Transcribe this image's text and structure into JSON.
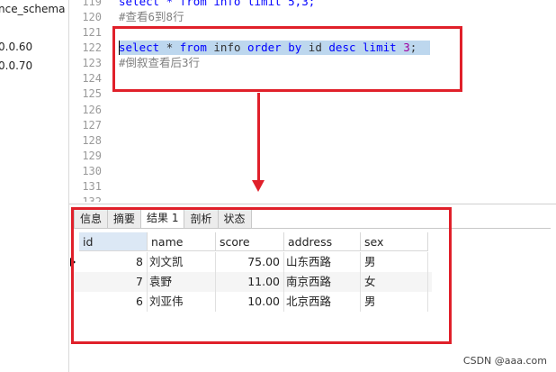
{
  "sidebar": {
    "items": [
      "nce_schema",
      "0.0.60",
      "0.0.70"
    ]
  },
  "editor": {
    "line_numbers": [
      "119",
      "120",
      "121",
      "122",
      "123",
      "124",
      "125",
      "126",
      "127",
      "128",
      "129",
      "130",
      "131",
      "132"
    ],
    "line_119": "select * from info limit 5,3;",
    "line_120_comment": "#查看6到8行",
    "line_122": {
      "kw_select": "select",
      "star": "*",
      "kw_from": "from",
      "table": "info",
      "kw_order": "order",
      "kw_by": "by",
      "col": "id",
      "kw_desc": "desc",
      "kw_limit": "limit",
      "num": "3",
      "semi": ";"
    },
    "line_123_comment": "#倒叙查看后3行"
  },
  "results": {
    "tabs": [
      "信息",
      "摘要",
      "结果 1",
      "剖析",
      "状态"
    ],
    "active_tab": "结果 1",
    "columns": [
      "id",
      "name",
      "score",
      "address",
      "sex"
    ],
    "rows": [
      [
        "8",
        "刘文凯",
        "75.00",
        "山东西路",
        "男"
      ],
      [
        "7",
        "袁野",
        "11.00",
        "南京西路",
        "女"
      ],
      [
        "6",
        "刘亚伟",
        "10.00",
        "北京西路",
        "男"
      ]
    ]
  },
  "annotation_color": "#e0202a",
  "watermark": "CSDN @aaa.com"
}
